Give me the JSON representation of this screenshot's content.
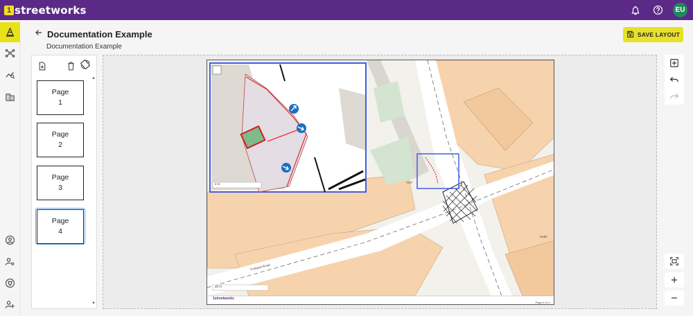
{
  "app": {
    "logo_digit": "1",
    "logo_text": "streetworks",
    "user_initials": "EU",
    "brand_color": "#5b2a86",
    "accent_color": "#e6e12a"
  },
  "header": {
    "title": "Documentation Example",
    "subtitle": "Documentation Example"
  },
  "toolbar": {
    "save_label": "SAVE LAYOUT"
  },
  "pages": [
    {
      "label": "Page",
      "number": "1"
    },
    {
      "label": "Page",
      "number": "2"
    },
    {
      "label": "Page",
      "number": "3"
    },
    {
      "label": "Page",
      "number": "4"
    }
  ],
  "selected_page": 4,
  "map": {
    "inset_scale": "2 m",
    "main_scale": "20 m",
    "road_label": "Portland Road",
    "street_code": "TCP",
    "label_hotel": "Hotel",
    "footer_brand": "1streetworks",
    "page_marker": "Page 4 of 4"
  },
  "icons": {
    "bell": "bell-icon",
    "help": "help-icon",
    "back": "arrow-back-icon",
    "save": "floppy-disk-icon"
  }
}
